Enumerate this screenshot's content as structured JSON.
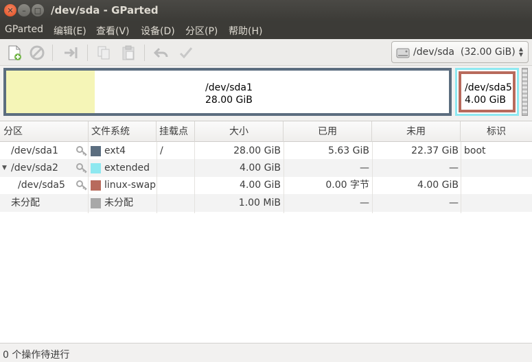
{
  "window": {
    "title": "/dev/sda - GParted"
  },
  "menu": [
    "GParted",
    "编辑(E)",
    "查看(V)",
    "设备(D)",
    "分区(P)",
    "帮助(H)"
  ],
  "toolbar": {
    "icons": [
      "new-partition-icon",
      "delete-icon",
      "resize-move-icon",
      "copy-icon",
      "paste-icon",
      "undo-icon",
      "apply-icon"
    ],
    "device": {
      "path": "/dev/sda",
      "size": "(32.00 GiB)"
    }
  },
  "diskmap": {
    "main": {
      "name": "/dev/sda1",
      "size": "28.00 GiB",
      "used_fraction": 0.2
    },
    "logical": {
      "name": "/dev/sda5",
      "size": "4.00 GiB"
    },
    "colors": {
      "ext4": "#5b6d7f",
      "extended": "#8ee8f0",
      "linux_swap": "#b86a5c",
      "unallocated": "#a8a8a8",
      "used": "#f5f5b7"
    }
  },
  "table": {
    "headers": [
      "分区",
      "文件系统",
      "挂载点",
      "大小",
      "已用",
      "未用",
      "标识"
    ],
    "rows": [
      {
        "partition": "/dev/sda1",
        "filesystem": "ext4",
        "mount": "/",
        "size": "28.00 GiB",
        "used": "5.63 GiB",
        "unused": "22.37 GiB",
        "flags": "boot",
        "swatch": "#5b6d7f",
        "key": true,
        "expander": "",
        "indent": 0
      },
      {
        "partition": "/dev/sda2",
        "filesystem": "extended",
        "mount": "",
        "size": "4.00 GiB",
        "used": "—",
        "unused": "—",
        "flags": "",
        "swatch": "#8ee8f0",
        "key": true,
        "expander": "▼",
        "indent": 0
      },
      {
        "partition": "/dev/sda5",
        "filesystem": "linux-swap",
        "mount": "",
        "size": "4.00 GiB",
        "used": "0.00 字节",
        "unused": "4.00 GiB",
        "flags": "",
        "swatch": "#b86a5c",
        "key": true,
        "expander": "",
        "indent": 10
      },
      {
        "partition": "未分配",
        "filesystem": "未分配",
        "mount": "",
        "size": "1.00 MiB",
        "used": "—",
        "unused": "—",
        "flags": "",
        "swatch": "#a8a8a8",
        "key": false,
        "expander": "",
        "indent": 0
      }
    ]
  },
  "status": {
    "text": "0 个操作待进行"
  }
}
